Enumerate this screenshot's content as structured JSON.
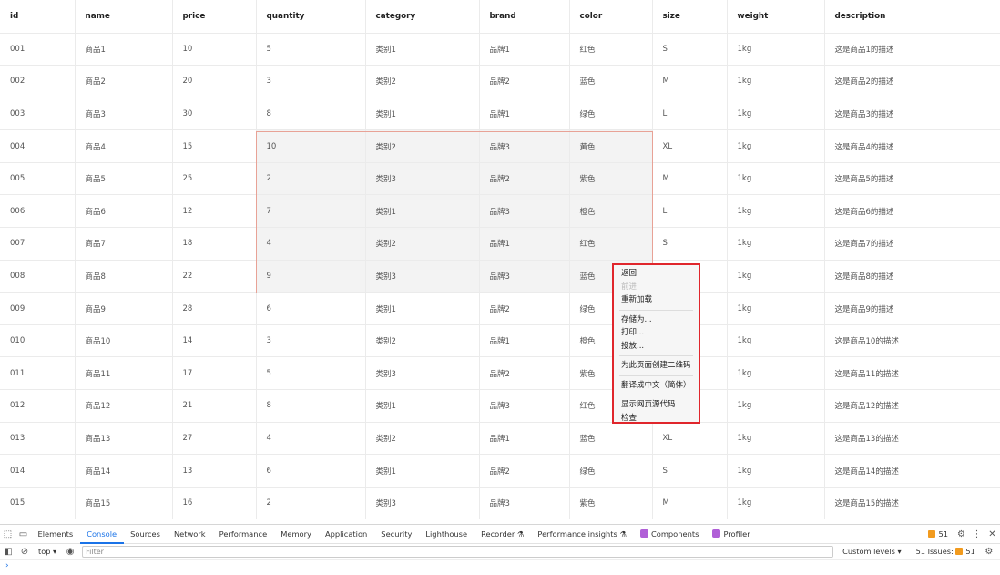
{
  "table": {
    "headers": [
      "id",
      "name",
      "price",
      "quantity",
      "category",
      "brand",
      "color",
      "size",
      "weight",
      "description"
    ],
    "rows": [
      [
        "001",
        "商品1",
        "10",
        "5",
        "类别1",
        "品牌1",
        "红色",
        "S",
        "1kg",
        "这是商品1的描述"
      ],
      [
        "002",
        "商品2",
        "20",
        "3",
        "类别2",
        "品牌2",
        "蓝色",
        "M",
        "1kg",
        "这是商品2的描述"
      ],
      [
        "003",
        "商品3",
        "30",
        "8",
        "类别1",
        "品牌1",
        "绿色",
        "L",
        "1kg",
        "这是商品3的描述"
      ],
      [
        "004",
        "商品4",
        "15",
        "10",
        "类别2",
        "品牌3",
        "黄色",
        "XL",
        "1kg",
        "这是商品4的描述"
      ],
      [
        "005",
        "商品5",
        "25",
        "2",
        "类别3",
        "品牌2",
        "紫色",
        "M",
        "1kg",
        "这是商品5的描述"
      ],
      [
        "006",
        "商品6",
        "12",
        "7",
        "类别1",
        "品牌3",
        "橙色",
        "L",
        "1kg",
        "这是商品6的描述"
      ],
      [
        "007",
        "商品7",
        "18",
        "4",
        "类别2",
        "品牌1",
        "红色",
        "S",
        "1kg",
        "这是商品7的描述"
      ],
      [
        "008",
        "商品8",
        "22",
        "9",
        "类别3",
        "品牌3",
        "蓝色",
        "",
        "1kg",
        "这是商品8的描述"
      ],
      [
        "009",
        "商品9",
        "28",
        "6",
        "类别1",
        "品牌2",
        "绿色",
        "",
        "1kg",
        "这是商品9的描述"
      ],
      [
        "010",
        "商品10",
        "14",
        "3",
        "类别2",
        "品牌1",
        "橙色",
        "",
        "1kg",
        "这是商品10的描述"
      ],
      [
        "011",
        "商品11",
        "17",
        "5",
        "类别3",
        "品牌2",
        "紫色",
        "",
        "1kg",
        "这是商品11的描述"
      ],
      [
        "012",
        "商品12",
        "21",
        "8",
        "类别1",
        "品牌3",
        "红色",
        "",
        "1kg",
        "这是商品12的描述"
      ],
      [
        "013",
        "商品13",
        "27",
        "4",
        "类别2",
        "品牌1",
        "蓝色",
        "XL",
        "1kg",
        "这是商品13的描述"
      ],
      [
        "014",
        "商品14",
        "13",
        "6",
        "类别1",
        "品牌2",
        "绿色",
        "S",
        "1kg",
        "这是商品14的描述"
      ],
      [
        "015",
        "商品15",
        "16",
        "2",
        "类别3",
        "品牌3",
        "紫色",
        "M",
        "1kg",
        "这是商品15的描述"
      ]
    ]
  },
  "context_menu": {
    "groups": [
      [
        {
          "label": "返回",
          "enabled": true
        },
        {
          "label": "前进",
          "enabled": false
        },
        {
          "label": "重新加载",
          "enabled": true
        }
      ],
      [
        {
          "label": "存储为...",
          "enabled": true
        },
        {
          "label": "打印...",
          "enabled": true
        },
        {
          "label": "投放...",
          "enabled": true
        }
      ],
      [
        {
          "label": "为此页面创建二维码",
          "enabled": true
        }
      ],
      [
        {
          "label": "翻译成中文（简体）",
          "enabled": true
        }
      ],
      [
        {
          "label": "显示网页源代码",
          "enabled": true
        },
        {
          "label": "检查",
          "enabled": true
        }
      ]
    ]
  },
  "devtools": {
    "tabs": [
      "Elements",
      "Console",
      "Sources",
      "Network",
      "Performance",
      "Memory",
      "Application",
      "Security",
      "Lighthouse",
      "Recorder ⚗",
      "Performance insights ⚗",
      "Components",
      "Profiler"
    ],
    "active_tab": "Console",
    "warning_count": "51",
    "context": "top ▾",
    "filter_placeholder": "Filter",
    "levels": "Custom levels ▾",
    "issues_label": "51 Issues:",
    "issues_count": "51",
    "prompt": "›",
    "accent_color": "#1a73e8"
  }
}
